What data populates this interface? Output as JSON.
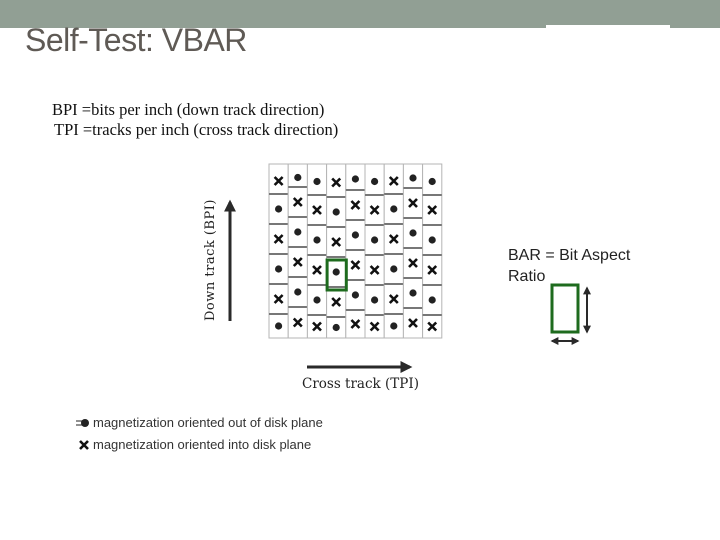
{
  "slide": {
    "title": "Self-Test: VBAR",
    "colors": {
      "banner": "#919f94",
      "title": "#5f5a55",
      "highlight": "#1e6b1e",
      "symbol": "#222222",
      "cell_border": "#777777"
    }
  },
  "definitions": [
    "BPI =bits per inch (down track direction)",
    "TPI =tracks per inch (cross track direction)"
  ],
  "axes": {
    "down_track_label": "Down track  (BPI)",
    "cross_track_label": "Cross track (TPI)"
  },
  "grid": {
    "columns": 9,
    "rows": 6,
    "cell_symbols": [
      [
        "x",
        "dot",
        "x",
        "dot",
        "x",
        "dot"
      ],
      [
        "dot",
        "x",
        "dot",
        "x",
        "dot",
        "x"
      ],
      [
        "dot",
        "x",
        "dot",
        "x",
        "dot",
        "x"
      ],
      [
        "x",
        "dot",
        "x",
        "dot",
        "x",
        "dot"
      ],
      [
        "dot",
        "x",
        "dot",
        "x",
        "dot",
        "x"
      ],
      [
        "dot",
        "x",
        "dot",
        "x",
        "dot",
        "x"
      ],
      [
        "x",
        "dot",
        "x",
        "dot",
        "x",
        "dot"
      ],
      [
        "dot",
        "x",
        "dot",
        "x",
        "dot",
        "x"
      ],
      [
        "dot",
        "x",
        "dot",
        "x",
        "dot",
        "x"
      ]
    ],
    "highlighted_cell": {
      "column": 4,
      "row": 4
    }
  },
  "bar_note": {
    "line1": "BAR = Bit Aspect",
    "line2": "Ratio"
  },
  "legend": [
    {
      "icon": "dot-icon",
      "label": "magnetization oriented out of disk plane"
    },
    {
      "icon": "x-icon",
      "label": "magnetization oriented into disk plane"
    }
  ]
}
